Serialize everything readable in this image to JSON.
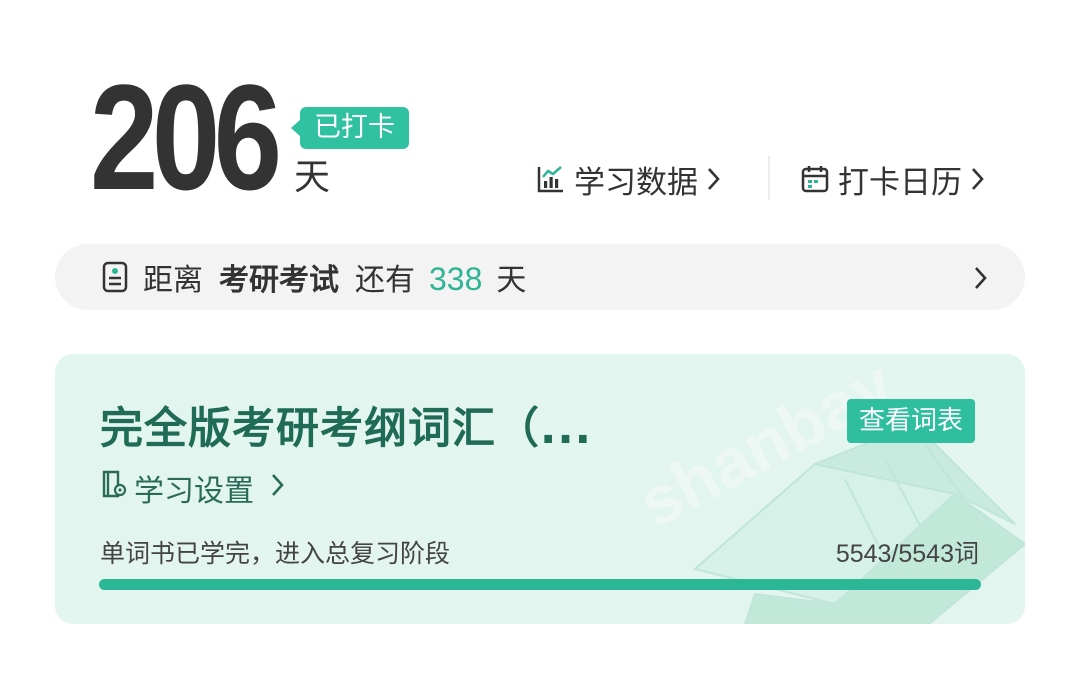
{
  "streak": {
    "days": "206",
    "checked_badge": "已打卡",
    "unit": "天"
  },
  "links": {
    "study_data": "学习数据",
    "checkin_calendar": "打卡日历",
    "chevron": "›"
  },
  "countdown": {
    "prefix": "距离",
    "exam_name": "考研考试",
    "middle": "还有",
    "days_left": "338",
    "suffix": "天"
  },
  "book": {
    "title": "完全版考研考纲词汇（...",
    "view_list_button": "查看词表",
    "settings_label": "学习设置",
    "status_text": "单词书已学完，进入总复习阶段",
    "progress_text": "5543/5543词",
    "progress_fraction": 1.0,
    "watermark": "shanbay"
  },
  "colors": {
    "accent": "#2fc1a0",
    "accent_text": "#2fb596",
    "card_bg": "#e3f5ef",
    "title_green": "#1f6b55"
  },
  "icons": {
    "study_data": "bar-chart-icon",
    "calendar": "calendar-icon",
    "countdown": "document-icon",
    "settings": "book-settings-icon"
  }
}
